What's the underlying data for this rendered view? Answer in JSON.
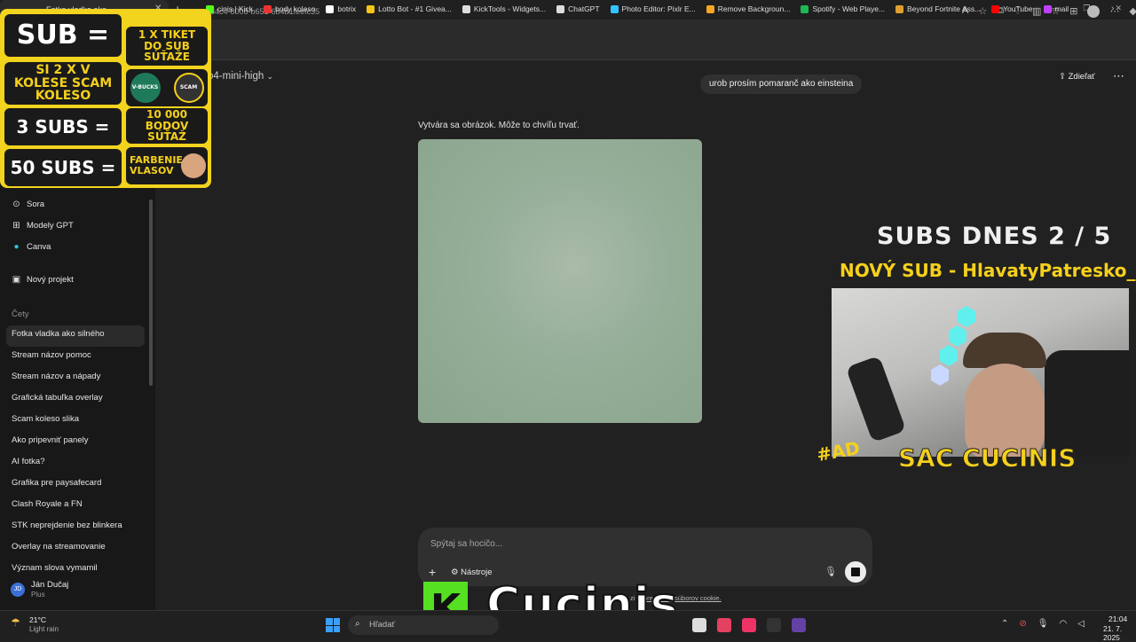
{
  "browser": {
    "tab_title": "Fotka vladka ako",
    "url": "84c4-8008-b651-6b4b1feefc35",
    "bookmarks": [
      "cinis | Kick",
      "body koleso",
      "botrix",
      "Lotto Bot - #1 Givea...",
      "KickTools - Widgets...",
      "ChatGPT",
      "Photo Editor: Pixlr E...",
      "Remove Backgroun...",
      "Spotify - Web Playe...",
      "Beyond Fortnite Ass...",
      "YouTube",
      "mail"
    ],
    "bookmark_colors": [
      "#53fc18",
      "#e33",
      "#fff",
      "#f5c518",
      "#ddd",
      "#ddd",
      "#33c3ff",
      "#f5a623",
      "#1db954",
      "#e0a030",
      "#ff0000",
      "#c040ff"
    ]
  },
  "sidebar": {
    "items": [
      {
        "label": "Sora",
        "icon": "play-circle-icon"
      },
      {
        "label": "Modely GPT",
        "icon": "grid-icon"
      },
      {
        "label": "Canva",
        "icon": "canva-icon"
      },
      {
        "label": "Nový projekt",
        "icon": "folder-plus-icon"
      }
    ],
    "section_chats": "Čety",
    "chats": [
      "Fotka vladka ako silného",
      "Stream názov pomoc",
      "Stream názov a nápady",
      "Grafická tabuľka overlay",
      "Scam koleso slika",
      "Ako pripevniť panely",
      "AI fotka?",
      "Grafika pre paysafecard",
      "Clash Royale a FN",
      "STK neprejdenie bez blinkera",
      "Overlay na streamovanie",
      "Význam slova vymamil"
    ],
    "user": {
      "initials": "JD",
      "name": "Ján Dučaj",
      "plan": "Plus"
    }
  },
  "main": {
    "model": "o4-mini-high",
    "share_label": "Zdieľať",
    "user_message": "urob prosím pomaranč ako einsteina",
    "status": "Vytvára sa obrázok. Môže to chvíľu trvať.",
    "composer_placeholder": "Spýtaj sa hocičo...",
    "tools_label": "Nástroje",
    "footnote_pre": "zi si",
    "footnote_link": "predvoľby súborov cookie."
  },
  "overlay": {
    "sub_label": "SUB =",
    "wheel_label": "SI 2 X V KOLESE SCAM KOLESO",
    "subs3": "3 SUBS =",
    "subs50": "50 SUBS =",
    "ticket": "1 X TIKET DO SUB SÚŤAŽE",
    "points": "10 000 BODOV SÚŤAŽ",
    "hair": "FARBENIE VLASOV",
    "wheel_a": "V-BUCKS",
    "wheel_b": "SCAM",
    "subs_today": "SUBS DNES  2 / 5",
    "new_sub": "NOVÝ SUB - HlavatyPatresko_Xd",
    "ad_tag": "#AD",
    "sac": "SAC CUCINIS",
    "k_letter": "K",
    "brand": "Cucinis"
  },
  "taskbar": {
    "temp": "21°C",
    "weather": "Light rain",
    "search": "Hľadať",
    "time": "21:04",
    "date": "21. 7. 2025",
    "app_colors": [
      "#ddd",
      "#e4405f",
      "#ee3366",
      "#333",
      "#6441a5"
    ]
  }
}
